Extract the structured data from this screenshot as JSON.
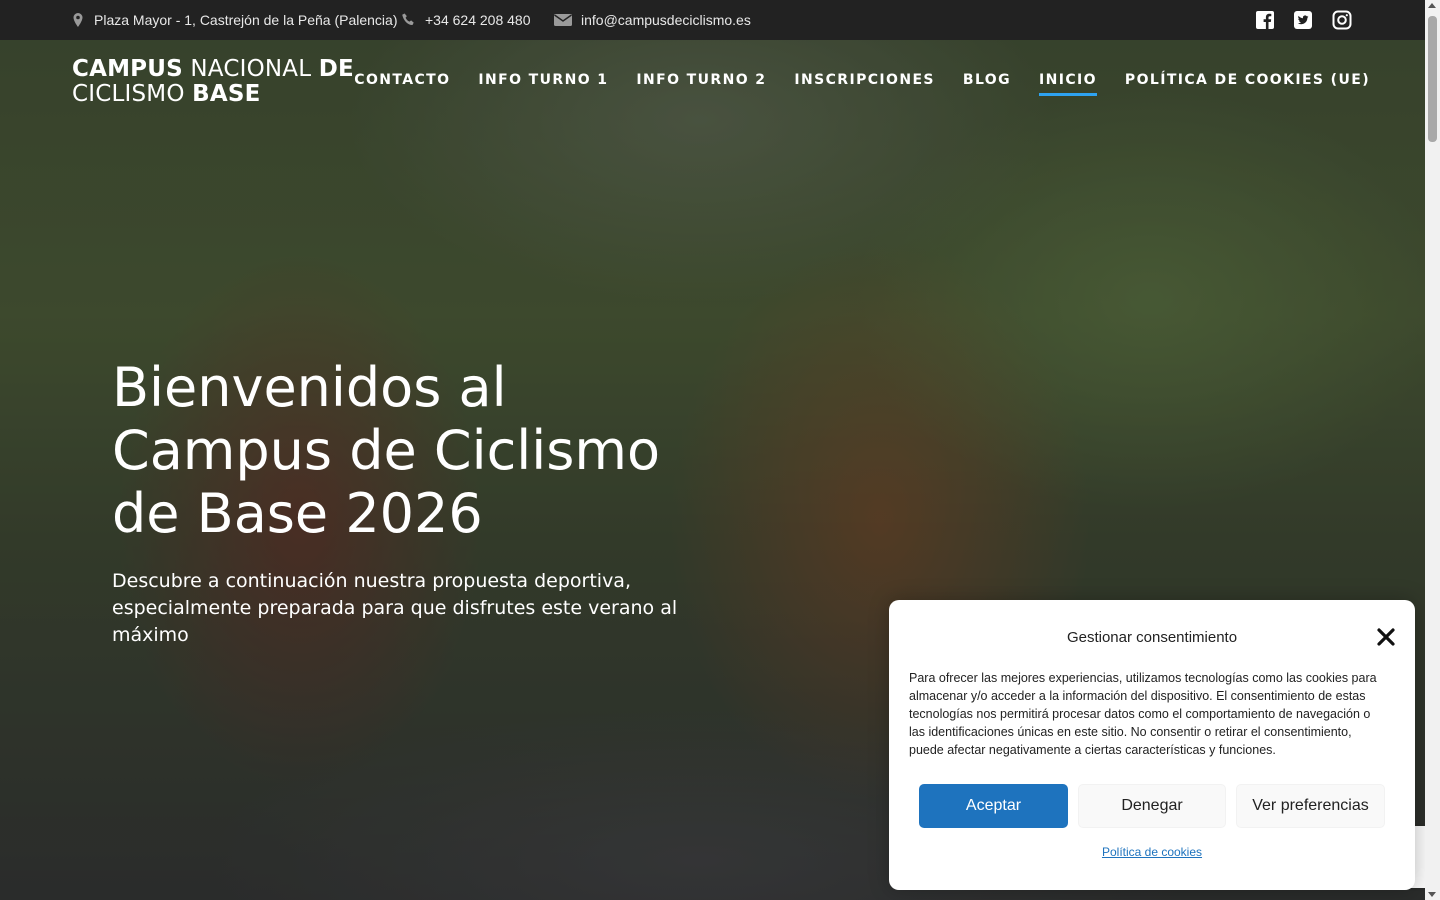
{
  "topbar": {
    "address": "Plaza Mayor - 1, Castrejón de la Peña (Palencia)",
    "phone": "+34 624 208 480",
    "email": "info@campusdeciclismo.es",
    "icons": [
      "map-marker-icon",
      "phone-icon",
      "envelope-icon",
      "facebook-icon",
      "twitter-icon",
      "instagram-icon"
    ]
  },
  "logo": {
    "line1_bold": "CAMPUS",
    "line1_thin": "NACIONAL",
    "line1_bold2": "DE",
    "line2_thin": "CICLISMO",
    "line2_bold": "BASE"
  },
  "nav": {
    "items": [
      {
        "label": "CONTACTO",
        "active": false
      },
      {
        "label": "INFO TURNO 1",
        "active": false
      },
      {
        "label": "INFO TURNO 2",
        "active": false
      },
      {
        "label": "INSCRIPCIONES",
        "active": false
      },
      {
        "label": "BLOG",
        "active": false
      },
      {
        "label": "INICIO",
        "active": true
      },
      {
        "label": "POLÍTICA DE COOKIES (UE)",
        "active": false
      }
    ],
    "accent_color": "#2ea3f2"
  },
  "hero": {
    "title": "Bienvenidos al Campus de Ciclismo de Base 2026",
    "subtitle": "Descubre a continuación nuestra propuesta deportiva, especialmente preparada para que disfrutes este verano al máximo"
  },
  "cookie_modal": {
    "title": "Gestionar consentimiento",
    "text": "Para ofrecer las mejores experiencias, utilizamos tecnologías como las cookies para almacenar y/o acceder a la información del dispositivo. El consentimiento de estas tecnologías nos permitirá procesar datos como el comportamiento de navegación o las identificaciones únicas en este sitio. No consentir o retirar el consentimiento, puede afectar negativamente a ciertas características y funciones.",
    "accept": "Aceptar",
    "deny": "Denegar",
    "preferences": "Ver preferencias",
    "policy_link": "Política de cookies",
    "primary_color": "#1e73be"
  }
}
